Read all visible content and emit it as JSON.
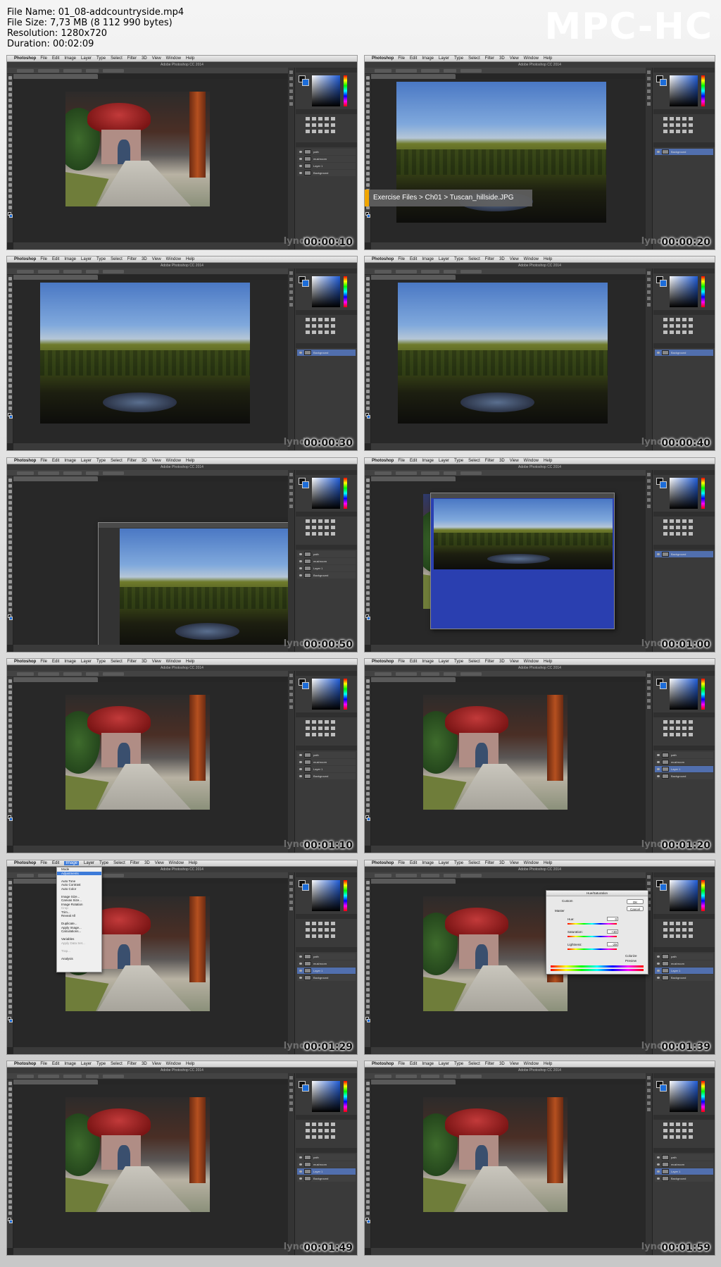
{
  "header": {
    "file_name_label": "File Name:",
    "file_name": "01_08-addcountryside.mp4",
    "file_size_label": "File Size:",
    "file_size": "7,73 MB (8 112 990 bytes)",
    "resolution_label": "Resolution:",
    "resolution": "1280x720",
    "duration_label": "Duration:",
    "duration": "00:02:09",
    "logo": "MPC-HC"
  },
  "app": {
    "apple": "",
    "name": "Photoshop",
    "menus": [
      "File",
      "Edit",
      "Image",
      "Layer",
      "Type",
      "Select",
      "Filter",
      "3D",
      "View",
      "Window",
      "Help"
    ],
    "window_title": "Adobe Photoshop CC 2014",
    "watermark": "lynda"
  },
  "caption": "Exercise Files > Ch01 > Tuscan_hillside.JPG",
  "image_menu": {
    "items": [
      "Mode",
      "Adjustments",
      "",
      "Auto Tone",
      "Auto Contrast",
      "Auto Color",
      "",
      "Image Size...",
      "Canvas Size...",
      "Image Rotation",
      "Crop",
      "Trim...",
      "Reveal All",
      "",
      "Duplicate...",
      "Apply Image...",
      "Calculations...",
      "",
      "Variables",
      "Apply Data Set...",
      "",
      "Trap...",
      "",
      "Analysis"
    ]
  },
  "hue_dialog": {
    "title": "Hue/Saturation",
    "ok": "OK",
    "cancel": "Cancel",
    "preset": "Custom",
    "channel": "Master",
    "hue_label": "Hue:",
    "hue": "0",
    "sat_label": "Saturation:",
    "sat": "+30",
    "light_label": "Lightness:",
    "light": "-29",
    "colorize": "Colorize",
    "preview": "Preview"
  },
  "layers": {
    "house": [
      "path",
      "mushroom",
      "Layer 1",
      "Background"
    ],
    "hill": [
      "Background"
    ]
  },
  "frames": [
    {
      "time": "00:00:10"
    },
    {
      "time": "00:00:20"
    },
    {
      "time": "00:00:30"
    },
    {
      "time": "00:00:40"
    },
    {
      "time": "00:00:50"
    },
    {
      "time": "00:01:00"
    },
    {
      "time": "00:01:10"
    },
    {
      "time": "00:01:20"
    },
    {
      "time": "00:01:29"
    },
    {
      "time": "00:01:39"
    },
    {
      "time": "00:01:49"
    },
    {
      "time": "00:01:59"
    }
  ],
  "colors": {
    "accent": "#f0a500",
    "menu_highlight": "#3d7bd9",
    "bg_swatch": "#1c6cd8"
  }
}
